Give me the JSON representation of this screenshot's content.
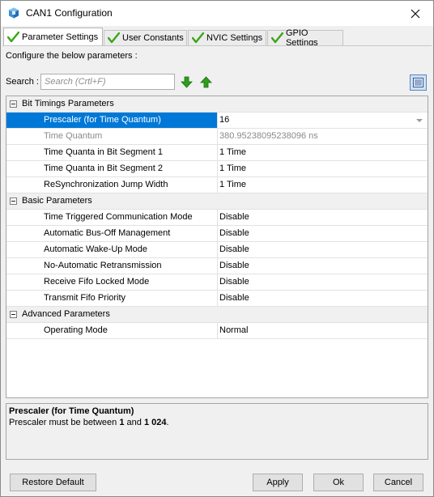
{
  "window": {
    "title": "CAN1 Configuration"
  },
  "tabs": [
    {
      "label": "Parameter Settings",
      "active": true
    },
    {
      "label": "User Constants",
      "active": false
    },
    {
      "label": "NVIC Settings",
      "active": false
    },
    {
      "label": "GPIO Settings",
      "active": false
    }
  ],
  "panel": {
    "configure_text": "Configure the below parameters :",
    "search_label": "Search :",
    "search_placeholder": "Search (Crtl+F)",
    "search_value": ""
  },
  "groups": {
    "bit_timings": {
      "label": "Bit Timings Parameters",
      "rows": [
        {
          "name": "Prescaler (for Time Quantum)",
          "value": "16",
          "selected": true
        },
        {
          "name": "Time Quantum",
          "value": "380.95238095238096 ns",
          "disabled": true
        },
        {
          "name": "Time Quanta in Bit Segment 1",
          "value": "1 Time"
        },
        {
          "name": "Time Quanta in Bit Segment 2",
          "value": "1 Time"
        },
        {
          "name": "ReSynchronization Jump Width",
          "value": "1 Time"
        }
      ]
    },
    "basic": {
      "label": "Basic Parameters",
      "rows": [
        {
          "name": "Time Triggered Communication Mode",
          "value": "Disable"
        },
        {
          "name": "Automatic Bus-Off Management",
          "value": "Disable"
        },
        {
          "name": "Automatic Wake-Up Mode",
          "value": "Disable"
        },
        {
          "name": "No-Automatic Retransmission",
          "value": "Disable"
        },
        {
          "name": "Receive Fifo Locked Mode",
          "value": "Disable"
        },
        {
          "name": "Transmit Fifo Priority",
          "value": "Disable"
        }
      ]
    },
    "advanced": {
      "label": "Advanced Parameters",
      "rows": [
        {
          "name": "Operating Mode",
          "value": "Normal"
        }
      ]
    }
  },
  "description": {
    "title": "Prescaler (for Time Quantum)",
    "text_prefix": "Prescaler must be between ",
    "min": "1",
    "text_middle": " and ",
    "max": "1 024",
    "text_suffix": "."
  },
  "buttons": {
    "restore": "Restore Default",
    "apply": "Apply",
    "ok": "Ok",
    "cancel": "Cancel"
  },
  "colors": {
    "selection": "#0078d7",
    "check_green": "#3aa617",
    "arrow_green": "#2e9e1c"
  }
}
